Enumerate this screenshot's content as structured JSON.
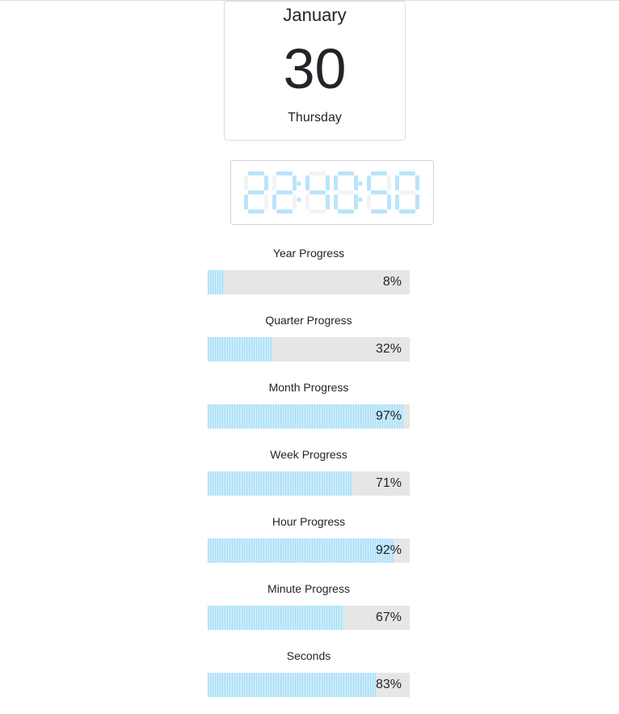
{
  "date": {
    "month": "January",
    "day": "30",
    "weekday": "Thursday"
  },
  "clock": {
    "time": "22:40:50",
    "digit_color": "#b9e4fb",
    "ghost_color": "#f3f3f3"
  },
  "progress": [
    {
      "label": "Year Progress",
      "percent": 8,
      "display": "8%"
    },
    {
      "label": "Quarter Progress",
      "percent": 32,
      "display": "32%"
    },
    {
      "label": "Month Progress",
      "percent": 97,
      "display": "97%"
    },
    {
      "label": "Week Progress",
      "percent": 71,
      "display": "71%"
    },
    {
      "label": "Hour Progress",
      "percent": 92,
      "display": "92%"
    },
    {
      "label": "Minute Progress",
      "percent": 67,
      "display": "67%"
    },
    {
      "label": "Seconds",
      "percent": 83,
      "display": "83%"
    }
  ],
  "colors": {
    "track": "#e6e6e6",
    "fill": "#b7e3f9"
  }
}
